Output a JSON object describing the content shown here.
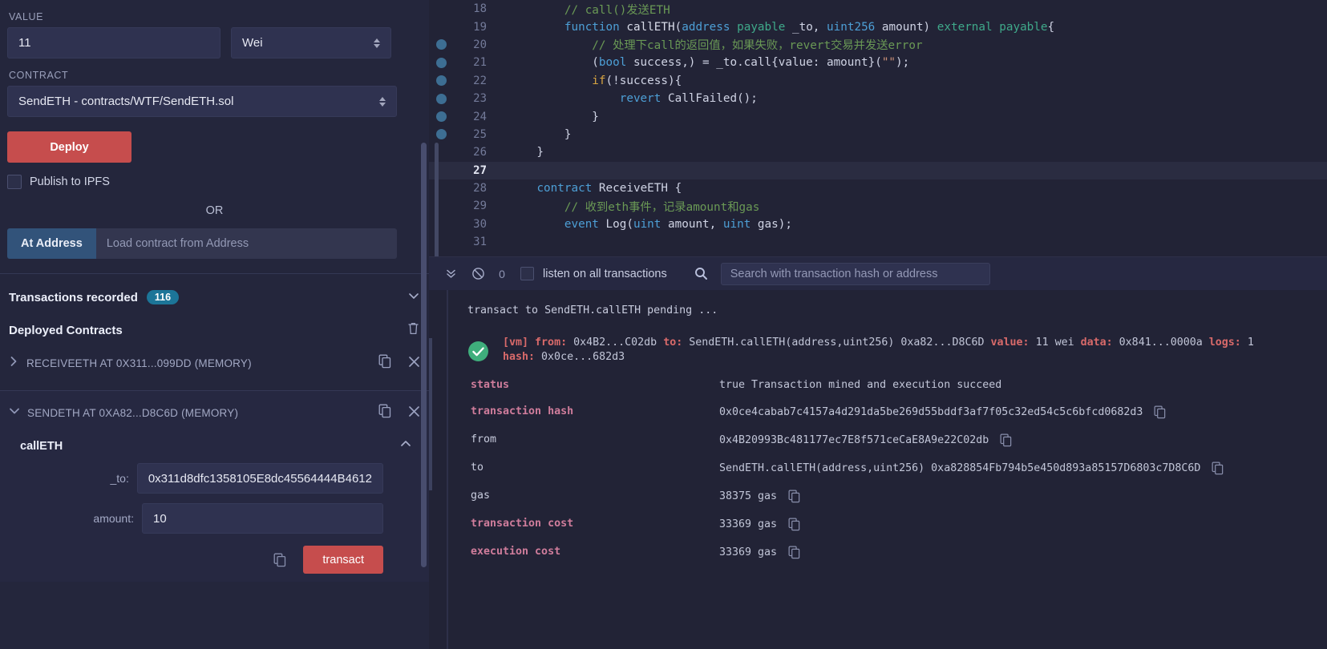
{
  "left_panel": {
    "value_label": "VALUE",
    "value_amount": "11",
    "value_unit": "Wei",
    "contract_label": "CONTRACT",
    "contract_selected": "SendETH - contracts/WTF/SendETH.sol",
    "deploy_button": "Deploy",
    "publish_ipfs_label": "Publish to IPFS",
    "or_text": "OR",
    "at_address_button": "At Address",
    "at_address_placeholder": "Load contract from Address",
    "transactions_recorded_label": "Transactions recorded",
    "transactions_recorded_count": "116",
    "deployed_contracts_label": "Deployed Contracts",
    "contracts": [
      {
        "title": "RECEIVEETH AT 0X311...099DD (MEMORY)",
        "expanded": false
      },
      {
        "title": "SENDETH AT 0XA82...D8C6D (MEMORY)",
        "expanded": true
      }
    ],
    "function_panel": {
      "name": "callETH",
      "params": [
        {
          "label": "_to:",
          "value": "0x311d8dfc1358105E8dc45564444B4612"
        },
        {
          "label": "amount:",
          "value": "10"
        }
      ],
      "transact_button": "transact"
    }
  },
  "editor": {
    "lines": [
      {
        "no": "18",
        "bp": false,
        "active": false,
        "tokens": [
          {
            "t": "        ",
            "c": "c-pln"
          },
          {
            "t": "// call()发送ETH",
            "c": "c-com"
          }
        ]
      },
      {
        "no": "19",
        "bp": false,
        "active": false,
        "tokens": [
          {
            "t": "        ",
            "c": "c-pln"
          },
          {
            "t": "function",
            "c": "c-kw"
          },
          {
            "t": " ",
            "c": "c-pln"
          },
          {
            "t": "callETH",
            "c": "c-fn"
          },
          {
            "t": "(",
            "c": "c-pln"
          },
          {
            "t": "address",
            "c": "c-type"
          },
          {
            "t": " ",
            "c": "c-pln"
          },
          {
            "t": "payable",
            "c": "c-kw2"
          },
          {
            "t": " _to, ",
            "c": "c-pln"
          },
          {
            "t": "uint256",
            "c": "c-type"
          },
          {
            "t": " amount) ",
            "c": "c-pln"
          },
          {
            "t": "external",
            "c": "c-kw2"
          },
          {
            "t": " ",
            "c": "c-pln"
          },
          {
            "t": "payable",
            "c": "c-kw2"
          },
          {
            "t": "{",
            "c": "c-pln"
          }
        ]
      },
      {
        "no": "20",
        "bp": true,
        "active": false,
        "tokens": [
          {
            "t": "            ",
            "c": "c-pln"
          },
          {
            "t": "// 处理下call的返回值，如果失败，revert交易并发送error",
            "c": "c-com"
          }
        ]
      },
      {
        "no": "21",
        "bp": true,
        "active": false,
        "tokens": [
          {
            "t": "            (",
            "c": "c-pln"
          },
          {
            "t": "bool",
            "c": "c-type"
          },
          {
            "t": " success,) = _to.call{value: amount}(",
            "c": "c-pln"
          },
          {
            "t": "\"\"",
            "c": "c-str"
          },
          {
            "t": ");",
            "c": "c-pln"
          }
        ]
      },
      {
        "no": "22",
        "bp": true,
        "active": false,
        "tokens": [
          {
            "t": "            ",
            "c": "c-pln"
          },
          {
            "t": "if",
            "c": "c-ctl"
          },
          {
            "t": "(!success){",
            "c": "c-pln"
          }
        ]
      },
      {
        "no": "23",
        "bp": true,
        "active": false,
        "tokens": [
          {
            "t": "                ",
            "c": "c-pln"
          },
          {
            "t": "revert",
            "c": "c-kw"
          },
          {
            "t": " CallFailed();",
            "c": "c-pln"
          }
        ]
      },
      {
        "no": "24",
        "bp": true,
        "active": false,
        "tokens": [
          {
            "t": "            }",
            "c": "c-pln"
          }
        ]
      },
      {
        "no": "25",
        "bp": true,
        "active": false,
        "tokens": [
          {
            "t": "        }",
            "c": "c-pln"
          }
        ]
      },
      {
        "no": "26",
        "bp": false,
        "active": false,
        "tokens": [
          {
            "t": "    }",
            "c": "c-pln"
          }
        ]
      },
      {
        "no": "27",
        "bp": false,
        "active": true,
        "tokens": [
          {
            "t": "",
            "c": "c-pln"
          }
        ]
      },
      {
        "no": "28",
        "bp": false,
        "active": false,
        "tokens": [
          {
            "t": "    ",
            "c": "c-pln"
          },
          {
            "t": "contract",
            "c": "c-kw"
          },
          {
            "t": " ReceiveETH {",
            "c": "c-pln"
          }
        ]
      },
      {
        "no": "29",
        "bp": false,
        "active": false,
        "tokens": [
          {
            "t": "        ",
            "c": "c-pln"
          },
          {
            "t": "// 收到eth事件，记录amount和gas",
            "c": "c-com"
          }
        ]
      },
      {
        "no": "30",
        "bp": false,
        "active": false,
        "tokens": [
          {
            "t": "        ",
            "c": "c-pln"
          },
          {
            "t": "event",
            "c": "c-kw"
          },
          {
            "t": " Log(",
            "c": "c-pln"
          },
          {
            "t": "uint",
            "c": "c-type"
          },
          {
            "t": " amount, ",
            "c": "c-pln"
          },
          {
            "t": "uint",
            "c": "c-type"
          },
          {
            "t": " gas);",
            "c": "c-pln"
          }
        ]
      },
      {
        "no": "31",
        "bp": false,
        "active": false,
        "tokens": [
          {
            "t": "",
            "c": "c-pln"
          }
        ]
      }
    ]
  },
  "terminal_toolbar": {
    "pending_count": "0",
    "listen_label": "listen on all transactions",
    "search_placeholder": "Search with transaction hash or address"
  },
  "terminal": {
    "pending_text": "transact to SendETH.callETH pending ...",
    "summary": {
      "vm": "[vm]",
      "from_key": "from:",
      "from_val": "0x4B2...C02db",
      "to_key": "to:",
      "to_val": "SendETH.callETH(address,uint256) 0xa82...D8C6D",
      "value_key": "value:",
      "value_val": "11 wei",
      "data_key": "data:",
      "data_val": "0x841...0000a",
      "logs_key": "logs:",
      "logs_val": "1",
      "hash_key": "hash:",
      "hash_val": "0x0ce...682d3"
    },
    "details": [
      {
        "key": "status",
        "bold": true,
        "value": "true Transaction mined and execution succeed",
        "copy": false
      },
      {
        "key": "transaction hash",
        "bold": true,
        "value": "0x0ce4cabab7c4157a4d291da5be269d55bddf3af7f05c32ed54c5c6bfcd0682d3",
        "copy": true
      },
      {
        "key": "from",
        "bold": false,
        "value": "0x4B20993Bc481177ec7E8f571ceCaE8A9e22C02db",
        "copy": true
      },
      {
        "key": "to",
        "bold": false,
        "value": "SendETH.callETH(address,uint256) 0xa828854Fb794b5e450d893a85157D6803c7D8C6D",
        "copy": true
      },
      {
        "key": "gas",
        "bold": false,
        "value": "38375 gas",
        "copy": true
      },
      {
        "key": "transaction cost",
        "bold": true,
        "value": "33369 gas",
        "copy": true
      },
      {
        "key": "execution cost",
        "bold": true,
        "value": "33369 gas",
        "copy": true
      }
    ]
  },
  "colors": {
    "accent_red": "#c64d4d",
    "accent_blue": "#32537a",
    "badge_blue": "#1c7598",
    "success_green": "#3fae7c",
    "panel_bg": "#24263c",
    "editor_bg": "#222336"
  }
}
